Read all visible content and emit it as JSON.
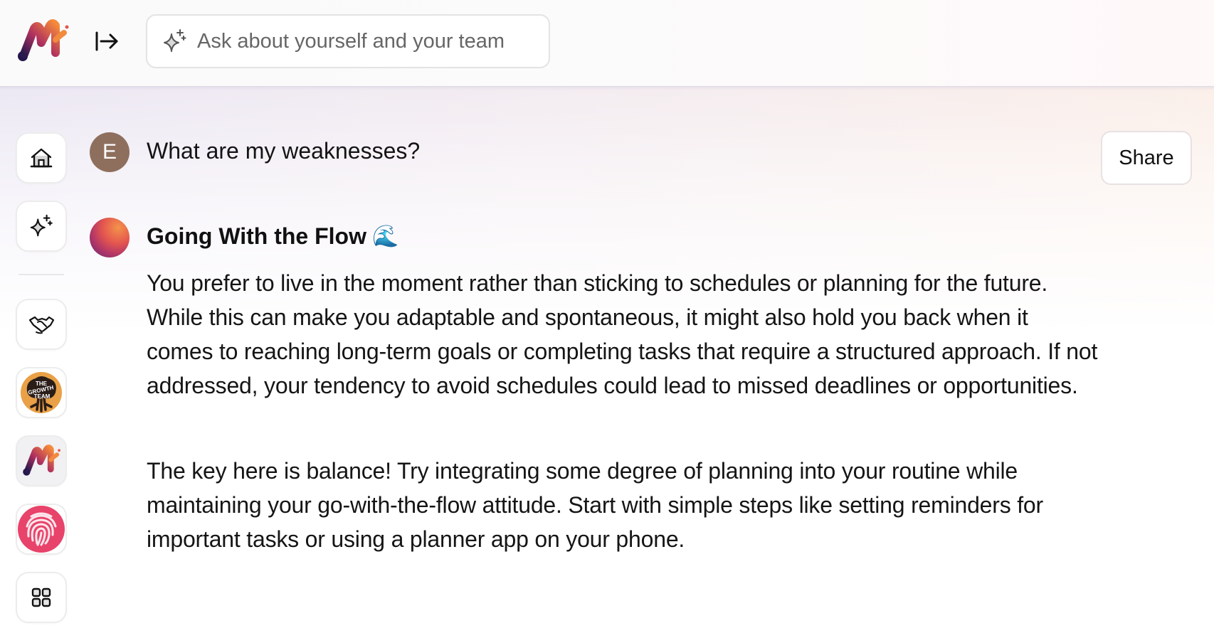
{
  "app": {
    "logo_name": "M logo"
  },
  "topbar": {
    "collapse_icon": "arrow-right-from-bar-icon",
    "search": {
      "icon": "sparkle-icon",
      "placeholder": "Ask about yourself and your team",
      "value": ""
    }
  },
  "sidebar": {
    "items": [
      {
        "name": "home",
        "icon": "home-icon"
      },
      {
        "name": "ask-ai",
        "icon": "sparkle-icon"
      },
      {
        "name": "connections",
        "icon": "handshake-icon"
      },
      {
        "name": "the-growth-team",
        "icon": "growth-team-logo",
        "label": "THE GROWTH TEAM"
      },
      {
        "name": "m-app",
        "icon": "m-logo-icon"
      },
      {
        "name": "fingerprint",
        "icon": "fingerprint-icon"
      },
      {
        "name": "apps",
        "icon": "grid-icon"
      }
    ]
  },
  "conversation": {
    "user": {
      "avatar_initial": "E",
      "message": "What are my weaknesses?"
    },
    "share_label": "Share",
    "answer": {
      "title": "Going With the Flow",
      "title_emoji": "🌊",
      "paragraphs": [
        "You prefer to live in the moment rather than sticking to schedules or planning for the future. While this can make you adaptable and spontaneous, it might also hold you back when it comes to reaching long-term goals or completing tasks that require a structured approach. If not addressed, your tendency to avoid schedules could lead to missed deadlines or opportunities.",
        "The key here is balance! Try integrating some degree of planning into your routine while maintaining your go-with-the-flow attitude. Start with simple steps like setting reminders for important tasks or using a planner app on your phone."
      ]
    }
  },
  "colors": {
    "avatar_user": "#8e6f5d",
    "fingerprint_bg": "#e8436a",
    "brand_orange": "#f08a3c",
    "brand_purple": "#5a2a74"
  }
}
